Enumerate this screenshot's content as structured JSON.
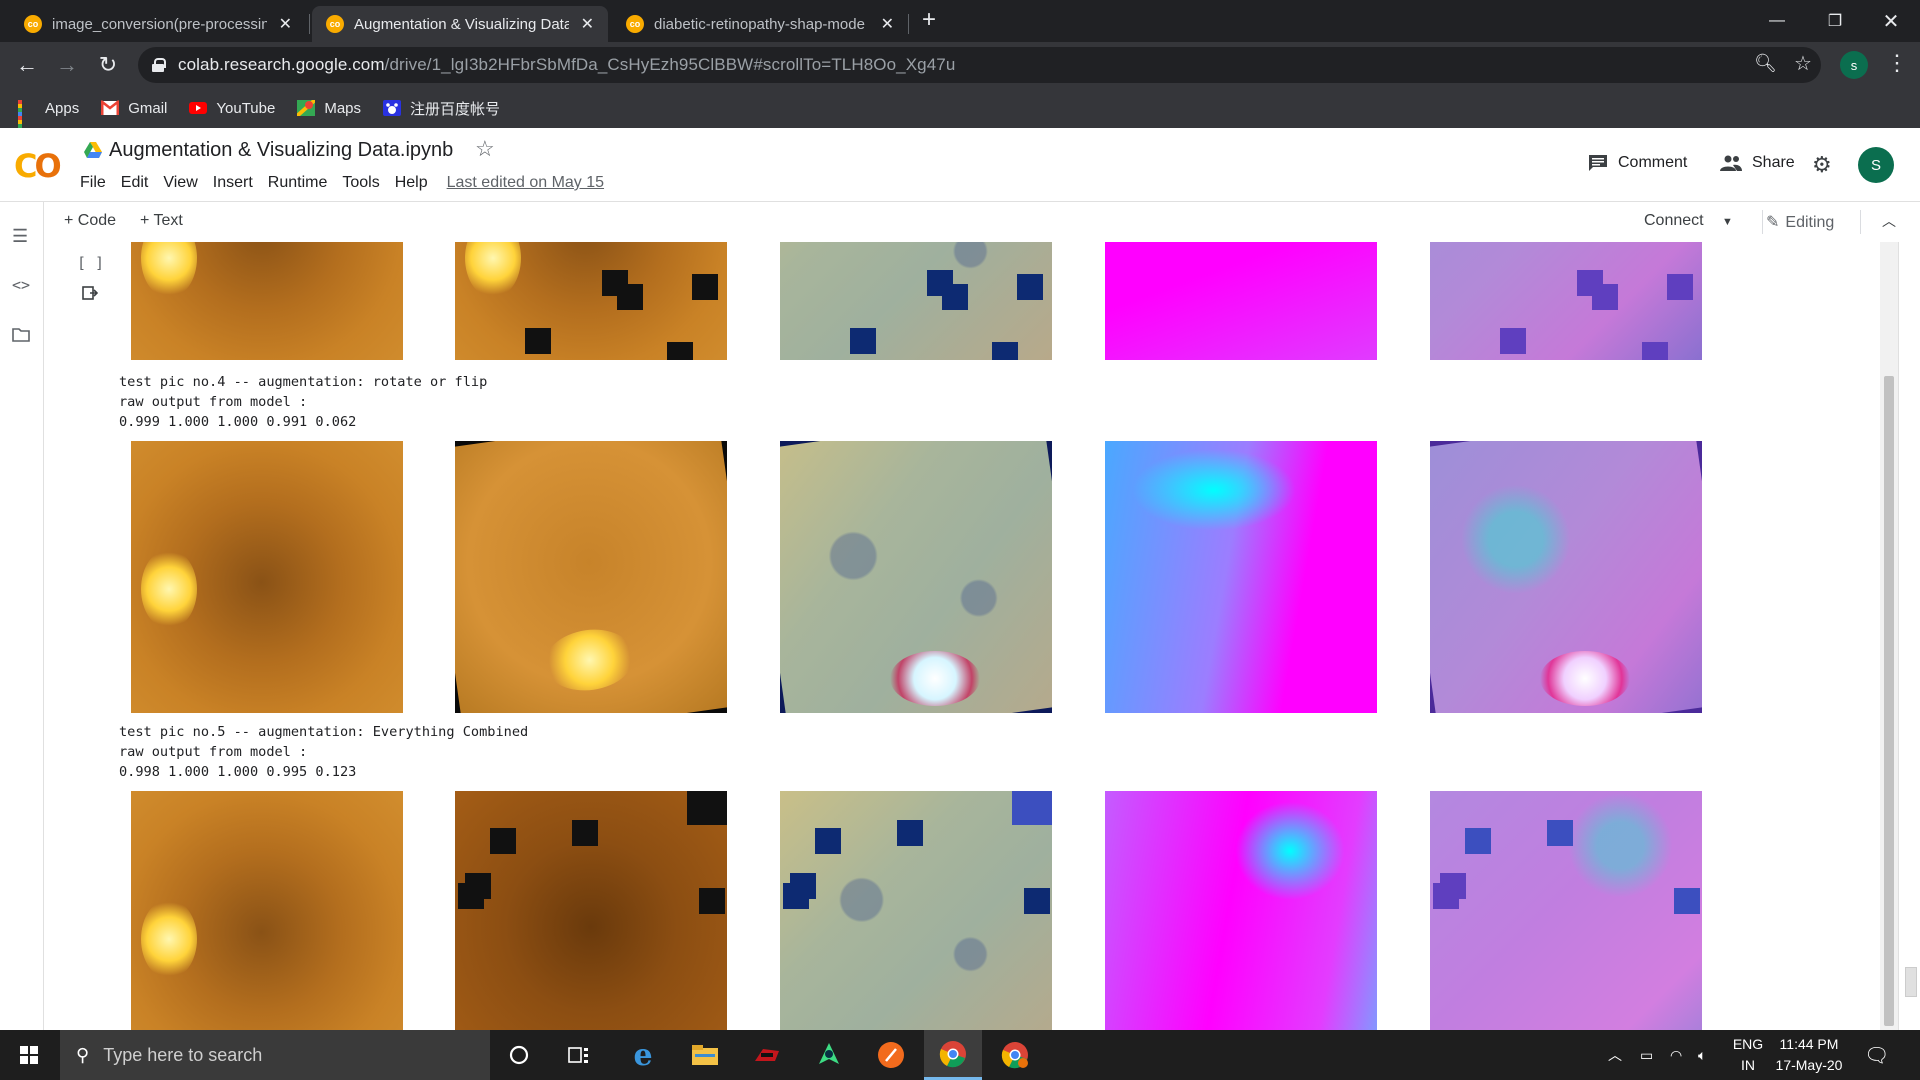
{
  "browser": {
    "tabs": [
      {
        "title": "image_conversion(pre-processing"
      },
      {
        "title": "Augmentation & Visualizing Data"
      },
      {
        "title": "diabetic-retinopathy-shap-mode"
      }
    ],
    "url_host": "colab.research.google.com",
    "url_path": "/drive/1_lgI3b2HFbrSbMfDa_CsHyEzh95ClBBW#scrollTo=TLH8Oo_Xg47u",
    "profile_initial": "s",
    "bookmarks": [
      {
        "label": "Apps",
        "icon": "apps-grid-icon"
      },
      {
        "label": "Gmail",
        "icon": "gmail-icon"
      },
      {
        "label": "YouTube",
        "icon": "youtube-icon"
      },
      {
        "label": "Maps",
        "icon": "maps-icon"
      },
      {
        "label": "注册百度帐号",
        "icon": "baidu-icon"
      }
    ]
  },
  "colab": {
    "logo": "CO",
    "notebook_title": "Augmentation & Visualizing Data.ipynb",
    "menu": [
      "File",
      "Edit",
      "View",
      "Insert",
      "Runtime",
      "Tools",
      "Help"
    ],
    "last_edited": "Last edited on May 15",
    "comment_label": "Comment",
    "share_label": "Share",
    "user_initial": "S",
    "toolbar": {
      "code_label": "Code",
      "text_label": "Text",
      "connect_label": "Connect",
      "editing_label": "Editing"
    },
    "cell_bracket": "[ ]"
  },
  "output": {
    "block4": {
      "line1": "test pic no.4 -- augmentation: rotate or flip",
      "line2": "raw output from model :",
      "line3": "0.999 1.000 1.000 0.991 0.062"
    },
    "block5": {
      "line1": "test pic no.5 -- augmentation: Everything Combined",
      "line2": "raw output from model :",
      "line3": "0.998 1.000 1.000 0.995 0.123"
    }
  },
  "taskbar": {
    "search_placeholder": "Type here to search",
    "lang_top": "ENG",
    "lang_bottom": "IN",
    "time": "11:44 PM",
    "date": "17-May-20"
  }
}
